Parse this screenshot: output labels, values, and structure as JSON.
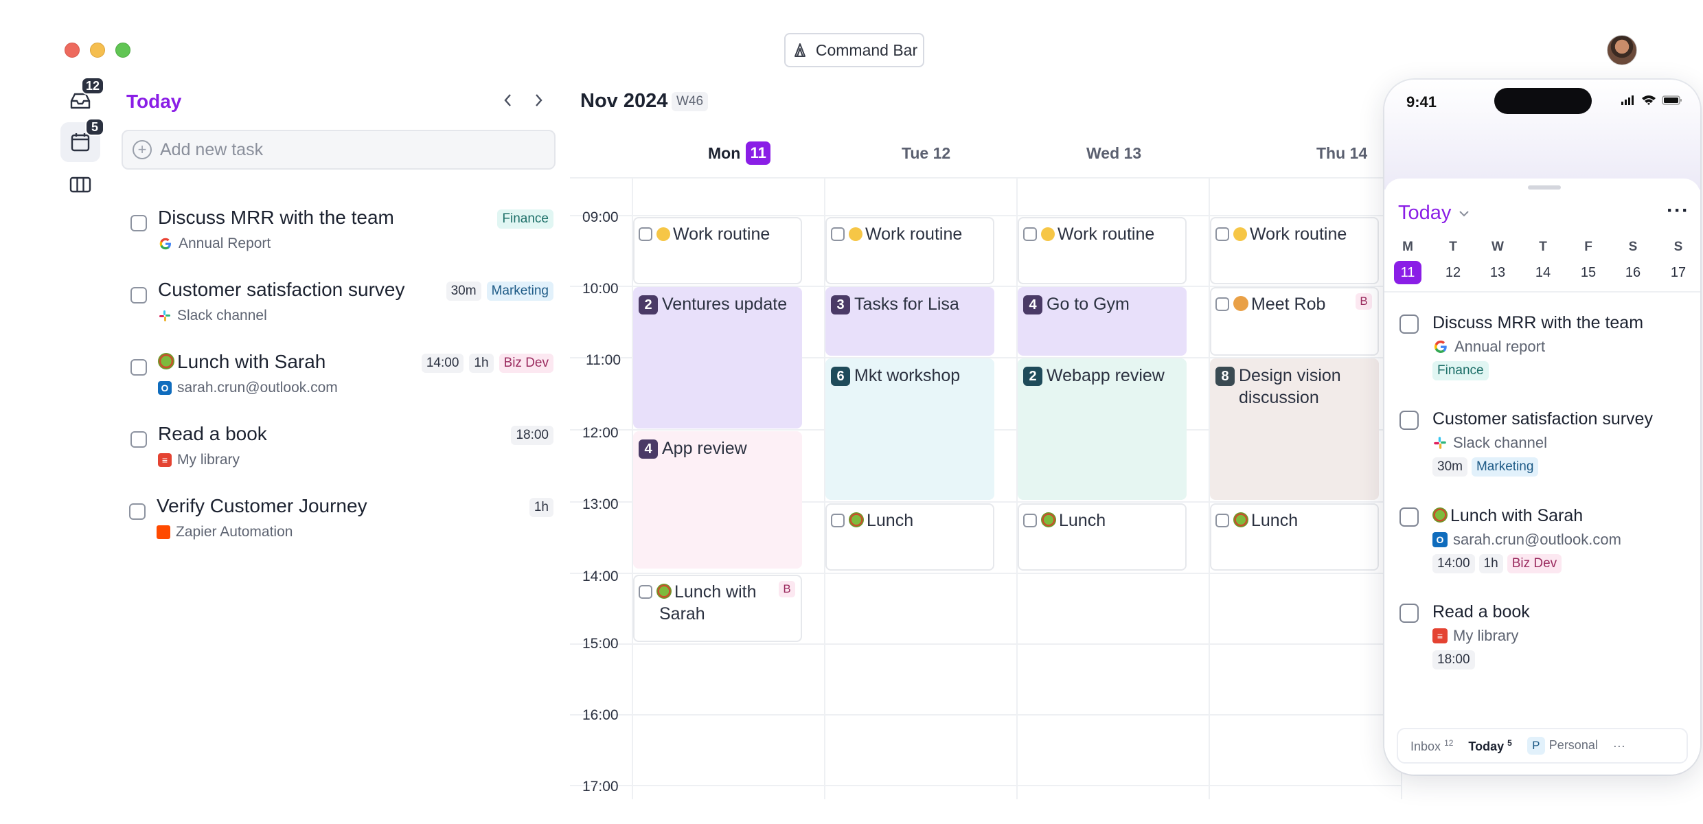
{
  "window": {
    "command_bar_label": "Command Bar"
  },
  "rail": {
    "inbox_count": "12",
    "today_count": "5"
  },
  "today_panel": {
    "title": "Today",
    "add_placeholder": "Add new task",
    "tasks": [
      {
        "title": "Discuss MRR with the team",
        "source": "Annual Report",
        "chips": [
          "Finance"
        ]
      },
      {
        "title": "Customer satisfaction survey",
        "source": "Slack channel",
        "chips": [
          "30m",
          "Marketing"
        ]
      },
      {
        "title": "Lunch with Sarah",
        "source": "sarah.crun@outlook.com",
        "chips": [
          "14:00",
          "1h",
          "Biz Dev"
        ]
      },
      {
        "title": "Read a book",
        "source": "My library",
        "chips": [
          "18:00"
        ]
      },
      {
        "title": "Verify Customer Journey",
        "source": "Zapier Automation",
        "chips": [
          "1h"
        ]
      }
    ]
  },
  "calendar": {
    "month": "Nov 2024",
    "week": "W46",
    "days": [
      {
        "name": "Mon",
        "num": "11"
      },
      {
        "name": "Tue 12"
      },
      {
        "name": "Wed 13"
      },
      {
        "name": "Thu 14"
      }
    ],
    "hours": [
      "09:00",
      "10:00",
      "11:00",
      "12:00",
      "13:00",
      "14:00",
      "15:00",
      "16:00",
      "17:00"
    ],
    "events": [
      {
        "label": "Work routine"
      },
      {
        "label": "Work routine"
      },
      {
        "label": "Work routine"
      },
      {
        "label": "Work routine"
      },
      {
        "label": "Ventures update",
        "count": "2"
      },
      {
        "label": "Tasks for Lisa",
        "count": "3"
      },
      {
        "label": "Go to Gym",
        "count": "4"
      },
      {
        "label": "Meet Rob",
        "tag": "B"
      },
      {
        "label": "Mkt workshop",
        "count": "6"
      },
      {
        "label": "Webapp review",
        "count": "2"
      },
      {
        "label": "Design vision discussion",
        "count": "8"
      },
      {
        "label": "App review",
        "count": "4"
      },
      {
        "label": "Lunch"
      },
      {
        "label": "Lunch"
      },
      {
        "label": "Lunch"
      },
      {
        "label": "Lunch with Sarah",
        "tag": "B"
      }
    ]
  },
  "phone": {
    "time": "9:41",
    "title": "Today",
    "weekdays": [
      "M",
      "T",
      "W",
      "T",
      "F",
      "S",
      "S"
    ],
    "dates": [
      "11",
      "12",
      "13",
      "14",
      "15",
      "16",
      "17"
    ],
    "tasks": [
      {
        "title": "Discuss MRR with the team",
        "source": "Annual report",
        "chips": [
          "Finance"
        ]
      },
      {
        "title": "Customer satisfaction survey",
        "source": "Slack channel",
        "chips": [
          "30m",
          "Marketing"
        ]
      },
      {
        "title": "Lunch with Sarah",
        "source": "sarah.crun@outlook.com",
        "chips": [
          "14:00",
          "1h",
          "Biz Dev"
        ]
      },
      {
        "title": "Read a book",
        "source": "My library",
        "chips": [
          "18:00"
        ]
      }
    ],
    "tabbar": {
      "inbox": "Inbox",
      "inbox_count": "12",
      "today": "Today",
      "today_count": "5",
      "personal_letter": "P",
      "personal": "Personal",
      "more": "···"
    }
  },
  "colors": {
    "accent": "#8a1ee6"
  }
}
